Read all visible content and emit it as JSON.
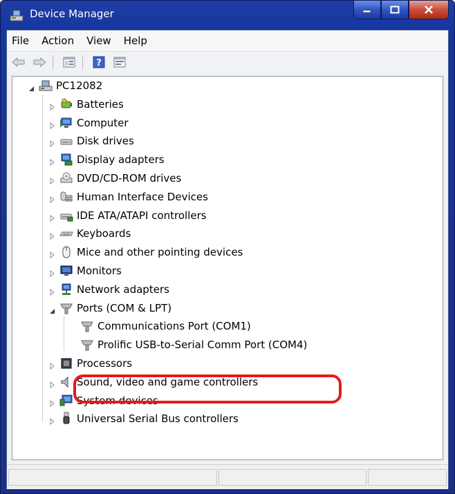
{
  "window": {
    "title": "Device Manager"
  },
  "menu": [
    "File",
    "Action",
    "View",
    "Help"
  ],
  "tree": {
    "root": "PC12082",
    "categories": [
      {
        "label": "Batteries",
        "icon": "battery-icon"
      },
      {
        "label": "Computer",
        "icon": "computer-icon"
      },
      {
        "label": "Disk drives",
        "icon": "disk-drive-icon"
      },
      {
        "label": "Display adapters",
        "icon": "display-adapter-icon"
      },
      {
        "label": "DVD/CD-ROM drives",
        "icon": "dvd-drive-icon"
      },
      {
        "label": "Human Interface Devices",
        "icon": "hid-icon"
      },
      {
        "label": "IDE ATA/ATAPI controllers",
        "icon": "ide-controller-icon"
      },
      {
        "label": "Keyboards",
        "icon": "keyboard-icon"
      },
      {
        "label": "Mice and other pointing devices",
        "icon": "mouse-icon"
      },
      {
        "label": "Monitors",
        "icon": "monitor-icon"
      },
      {
        "label": "Network adapters",
        "icon": "network-adapter-icon"
      },
      {
        "label": "Ports (COM & LPT)",
        "icon": "port-icon",
        "expanded": true,
        "children": [
          {
            "label": "Communications Port (COM1)",
            "icon": "port-icon"
          },
          {
            "label": "Prolific USB-to-Serial Comm Port (COM4)",
            "icon": "port-icon",
            "highlighted": true
          }
        ]
      },
      {
        "label": "Processors",
        "icon": "processor-icon"
      },
      {
        "label": "Sound, video and game controllers",
        "icon": "speaker-icon"
      },
      {
        "label": "System devices",
        "icon": "system-device-icon"
      },
      {
        "label": "Universal Serial Bus controllers",
        "icon": "usb-icon"
      }
    ]
  },
  "colors": {
    "highlight": "#e41b1b",
    "titlebar": "#1f3ea6"
  }
}
